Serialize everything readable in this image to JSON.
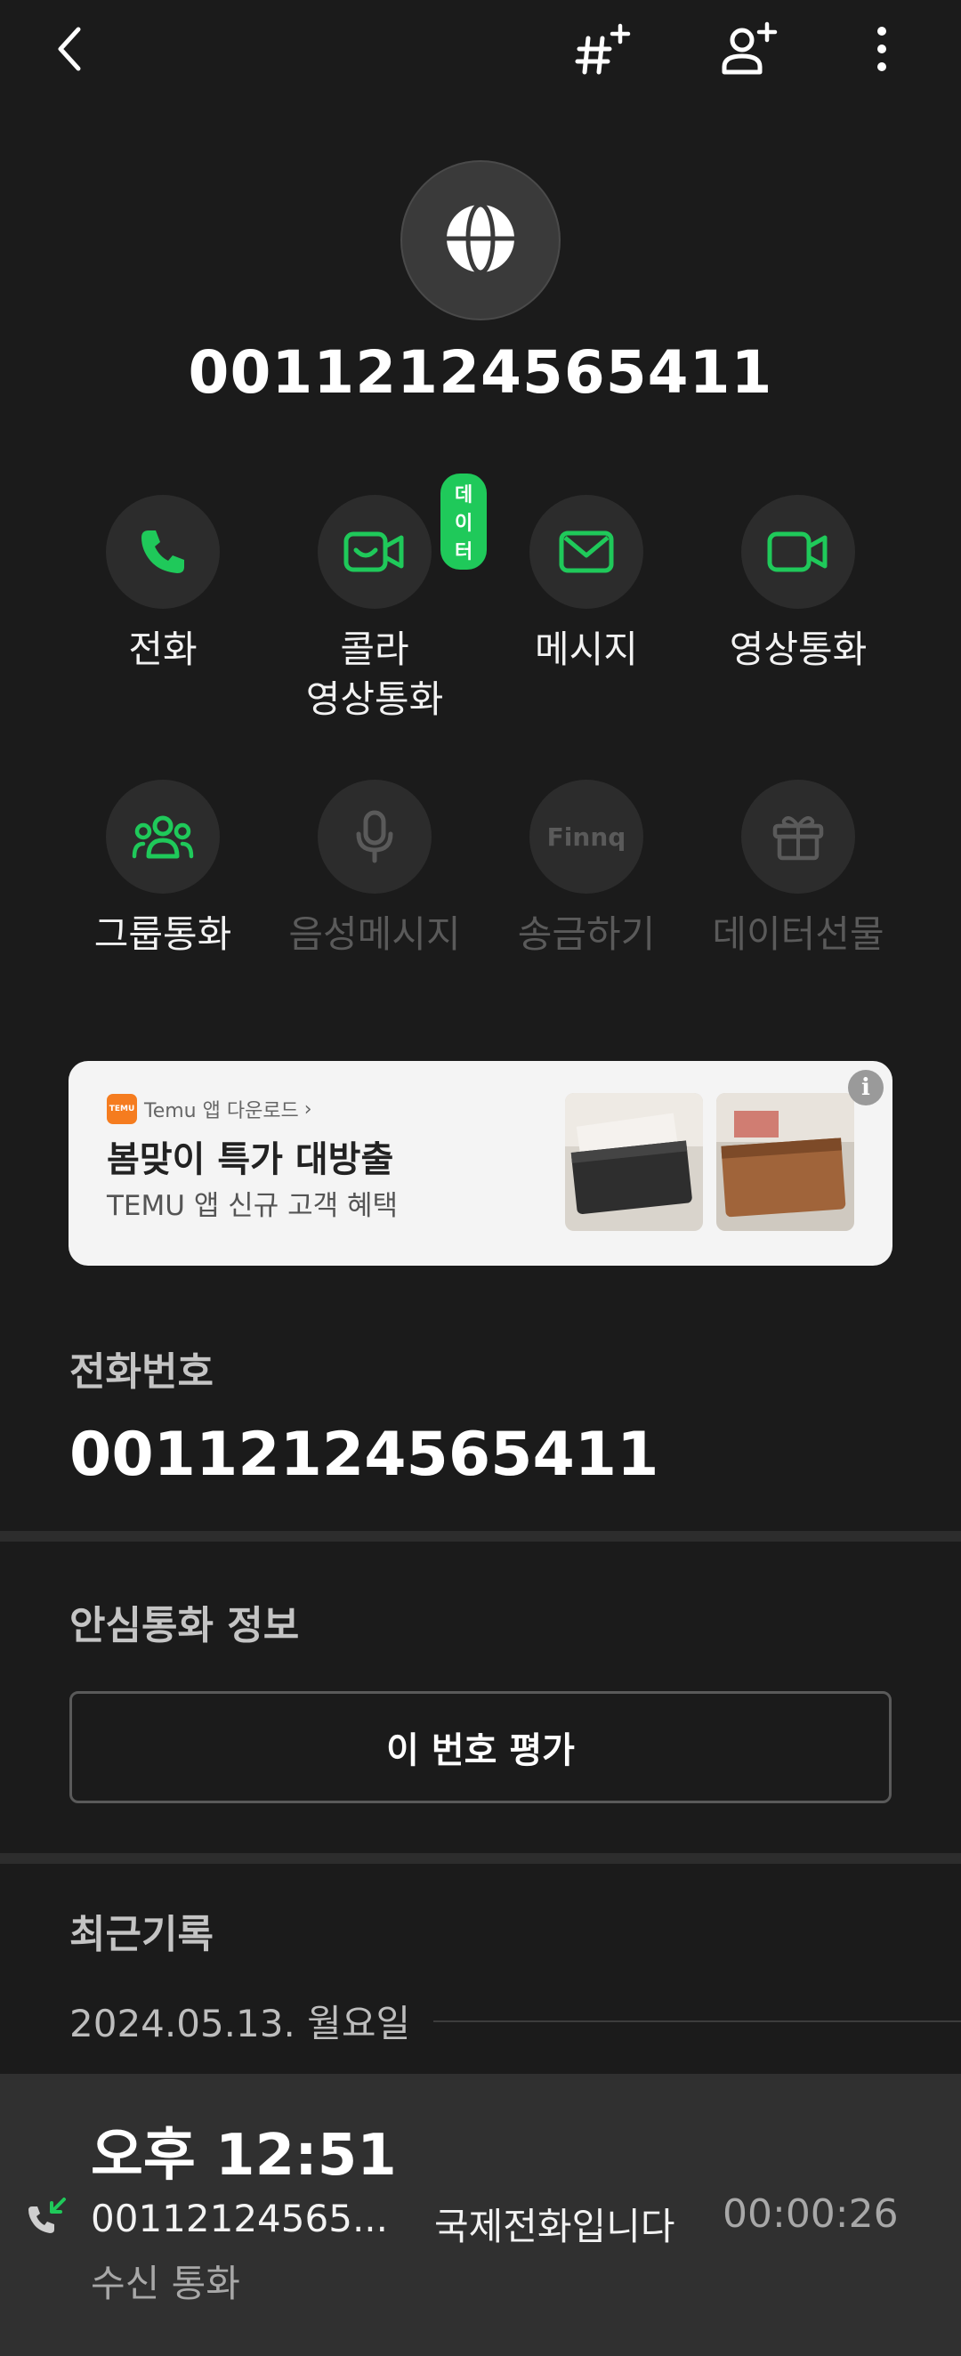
{
  "header": {
    "back_icon": "chevron-left-icon",
    "add_speed_dial_icon": "hash-plus-icon",
    "add_contact_icon": "person-plus-icon",
    "more_icon": "more-vertical-icon"
  },
  "contact": {
    "avatar_icon": "globe-icon",
    "number": "00112124565411"
  },
  "actions": [
    {
      "label": "전화",
      "icon": "phone-icon",
      "enabled": true
    },
    {
      "label": "콜라\n영상통화",
      "label1": "콜라",
      "label2": "영상통화",
      "icon": "video-chat-icon",
      "enabled": true,
      "badge": "데이터"
    },
    {
      "label": "메시지",
      "icon": "message-icon",
      "enabled": true
    },
    {
      "label": "영상통화",
      "icon": "video-camera-icon",
      "enabled": true
    },
    {
      "label": "그룹통화",
      "icon": "group-icon",
      "enabled": true
    },
    {
      "label": "음성메시지",
      "icon": "microphone-icon",
      "enabled": false
    },
    {
      "label": "송금하기",
      "icon": "finnq-icon",
      "enabled": false,
      "icon_text": "Finnq"
    },
    {
      "label": "데이터선물",
      "icon": "gift-icon",
      "enabled": false
    }
  ],
  "ad": {
    "brand": "Temu 앱 다운로드",
    "logo_text": "TEMU",
    "headline": "봄맞이 특가 대방출",
    "subtext": "TEMU 앱 신규 고객 혜택",
    "info_label": "i"
  },
  "phone_section": {
    "label": "전화번호",
    "number": "00112124565411"
  },
  "safe_call": {
    "label": "안심통화 정보",
    "rate_button": "이 번호 평가"
  },
  "recent": {
    "label": "최근기록",
    "date": "2024.05.13. 월요일",
    "entries": [
      {
        "time": "오후 12:51",
        "number": "00112124565...",
        "note": "국제전화입니다",
        "duration": "00:00:26",
        "type": "수신 통화",
        "icon": "incoming-call-icon"
      }
    ]
  },
  "colors": {
    "accent": "#1fc95a",
    "background": "#1b1b1b",
    "disabled": "#5a5a5a"
  }
}
